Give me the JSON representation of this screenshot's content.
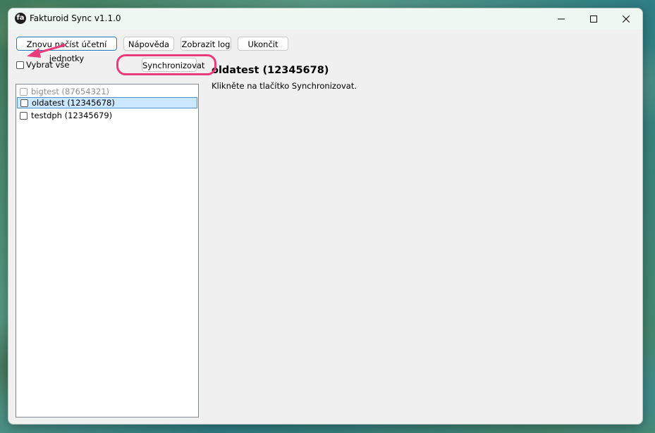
{
  "window": {
    "title": "Fakturoid Sync v1.1.0",
    "app_icon_glyph": "fa"
  },
  "toolbar": {
    "reload_label": "Znovu načíst účetní jednotky",
    "help_label": "Nápověda",
    "log_label": "Zobrazit log",
    "quit_label": "Ukončit"
  },
  "left_panel": {
    "select_all_label": "Vybrat vše",
    "sync_button_label": "Synchronizovat",
    "items": [
      {
        "label": "bigtest (87654321)",
        "disabled": true,
        "selected": false
      },
      {
        "label": "oldatest (12345678)",
        "disabled": false,
        "selected": true
      },
      {
        "label": "testdph (12345679)",
        "disabled": false,
        "selected": false
      }
    ]
  },
  "detail": {
    "title": "oldatest (12345678)",
    "message": "Klikněte na tlačítko Synchronizovat."
  },
  "icons": {
    "minimize": "minimize-icon",
    "maximize": "maximize-icon",
    "close": "close-icon"
  },
  "colors": {
    "annotation": "#ea3b7c",
    "selection_bg": "#cce8ff",
    "selection_border": "#4a8fd1",
    "focus_border": "#1a73b8"
  }
}
